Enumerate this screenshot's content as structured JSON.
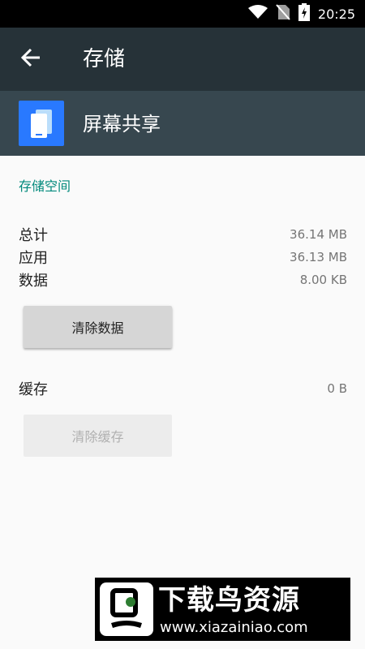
{
  "status_bar": {
    "time": "20:25",
    "icons": [
      "wifi-icon",
      "no-sim-icon",
      "battery-charging-icon"
    ]
  },
  "toolbar": {
    "title": "存储",
    "back_icon": "back-arrow-icon"
  },
  "app": {
    "name": "屏幕共享",
    "icon": "screen-share-app-icon",
    "icon_color": "#2979ff"
  },
  "storage": {
    "section_title": "存储空间",
    "total_label": "总计",
    "total_value": "36.14 MB",
    "app_label": "应用",
    "app_value": "36.13 MB",
    "data_label": "数据",
    "data_value": "8.00 KB",
    "clear_data_label": "清除数据",
    "cache_label": "缓存",
    "cache_value": "0 B",
    "clear_cache_label": "清除缓存"
  },
  "watermark": {
    "title": "下载鸟资源",
    "url": "www.xiazainiao.com"
  },
  "colors": {
    "toolbar": "#263238",
    "app_header": "#37474f",
    "accent": "#00897b"
  }
}
